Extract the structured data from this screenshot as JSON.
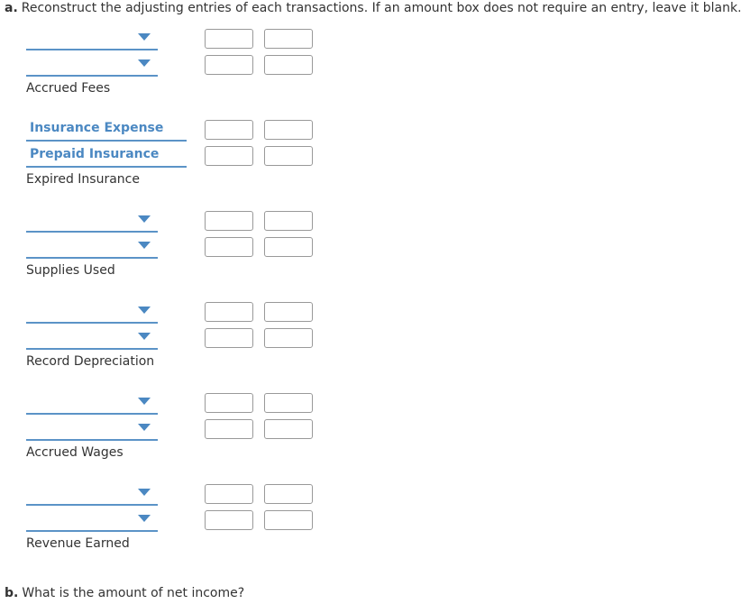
{
  "part_a": {
    "letter": "a.",
    "instruction": "Reconstruct the adjusting entries of each transactions. If an amount box does not require an entry, leave it blank."
  },
  "entries": [
    {
      "debit_account": "",
      "credit_account": "",
      "label": "Accrued Fees"
    },
    {
      "debit_account": "Insurance Expense",
      "credit_account": "Prepaid Insurance",
      "label": "Expired Insurance"
    },
    {
      "debit_account": "",
      "credit_account": "",
      "label": "Supplies Used"
    },
    {
      "debit_account": "",
      "credit_account": "",
      "label": "Record Depreciation"
    },
    {
      "debit_account": "",
      "credit_account": "",
      "label": "Accrued Wages"
    },
    {
      "debit_account": "",
      "credit_account": "",
      "label": "Revenue Earned"
    }
  ],
  "part_b": {
    "letter": "b.",
    "question": "What is the amount of net income?"
  }
}
